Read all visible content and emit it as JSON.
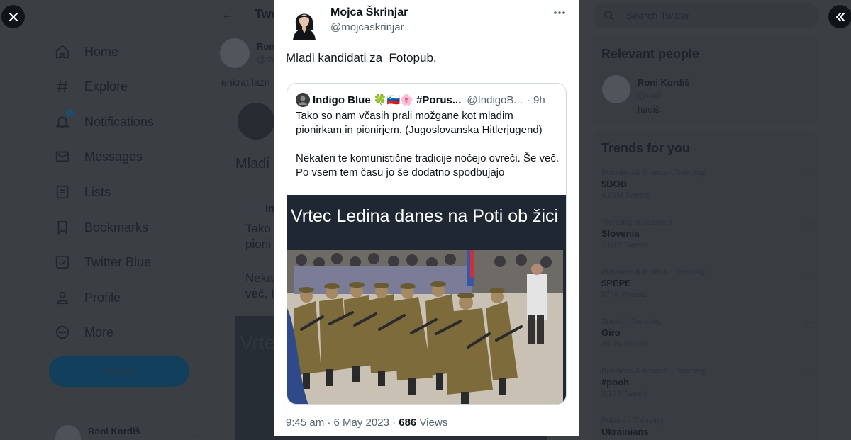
{
  "background": {
    "sidebar": {
      "nav_items": [
        {
          "label": "Home",
          "icon": "home-icon"
        },
        {
          "label": "Explore",
          "icon": "hashtag-icon"
        },
        {
          "label": "Notifications",
          "icon": "bell-icon"
        },
        {
          "label": "Messages",
          "icon": "envelope-icon"
        },
        {
          "label": "Lists",
          "icon": "list-icon"
        },
        {
          "label": "Bookmarks",
          "icon": "bookmark-icon"
        },
        {
          "label": "Twitter Blue",
          "icon": "twitter-blue-icon"
        },
        {
          "label": "Profile",
          "icon": "person-icon"
        },
        {
          "label": "More",
          "icon": "more-circle-icon"
        }
      ],
      "tweet_button": "Tweet",
      "account_name": "Roni Kordiš"
    },
    "main": {
      "header_title": "Twe",
      "author_name": "Roni",
      "author_handle": "@ra",
      "text_fragment": "enkrat lazn",
      "tweet_text": "Mladi k",
      "quote_name": "In",
      "quote_line1": "Tako",
      "quote_line2": "pioni",
      "quote_line3": "Neka",
      "quote_line4": "več. I",
      "image_caption": "Vrte"
    },
    "right": {
      "search_placeholder": "Search Twitter",
      "relevant_title": "Relevant people",
      "relevant_person": {
        "name": "Roni Kordiš",
        "handle": "@rad",
        "bio": "hadiš"
      },
      "trends_title": "Trends for you",
      "trends": [
        {
          "context": "Business & finance · Trending",
          "name": "$BOB",
          "count": "4.99M Tweets"
        },
        {
          "context": "Trending in Slovenia",
          "name": "Slovenia",
          "count": "1,692 Tweets"
        },
        {
          "context": "Business & finance · Trending",
          "name": "$PEPE",
          "count": "574K Tweets"
        },
        {
          "context": "Sports · Trending",
          "name": "Giro",
          "count": "30.9K Tweets"
        },
        {
          "context": "Business & finance · Trending",
          "name": "#pooh",
          "count": "3,177 Tweets"
        },
        {
          "context": "Politics · Trending",
          "name": "Ukrainians",
          "count": ""
        }
      ]
    }
  },
  "modal": {
    "author_name": "Mojca Škrinjar",
    "author_handle": "@mojcaskrinjar",
    "tweet_text": "Mladi kandidati za  Fotopub.",
    "quote": {
      "author_name": "Indigo Blue 🍀🇸🇮🌸 #Porus...",
      "author_handle": "@IndigoB...",
      "separator": "·",
      "time": "9h",
      "paragraph1": "Tako so nam včasih prali možgane kot mladim pionirkam in pionirjem. (Jugoslovanska Hitlerjugend)",
      "paragraph2": "Nekateri te komunistične tradicije nočejo ovreči. Še več. Po vsem tem času jo še dodatno spodbujajo",
      "image_caption": "Vrtec Ledina danes na Poti ob žici"
    },
    "timestamp": "9:45 am · 6 May 2023 ·",
    "views_count": "686",
    "views_label": "Views"
  },
  "colors": {
    "overlay": "#3b3f44",
    "modal_bg": "#ffffff",
    "text_primary": "#0f1419",
    "text_secondary": "#536471",
    "border": "#cfd9de"
  }
}
